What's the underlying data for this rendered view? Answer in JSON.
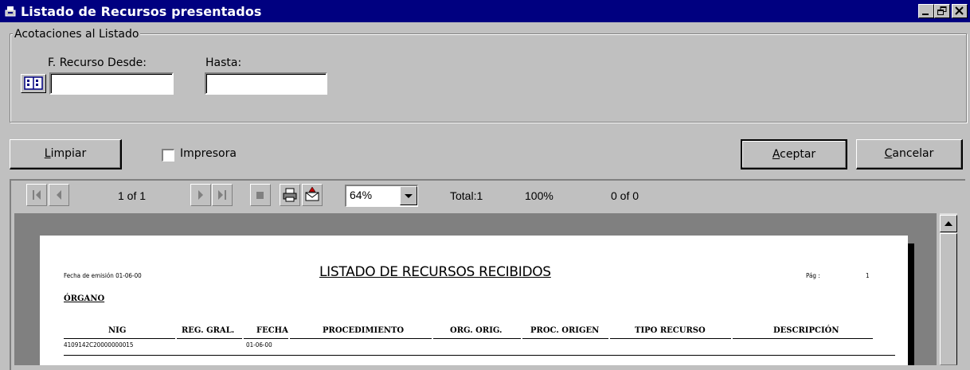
{
  "window": {
    "title": "Listado de Recursos presentados",
    "controls": [
      "minimize-icon",
      "maximize-icon",
      "close-icon"
    ]
  },
  "filters": {
    "group_label": "Acotaciones al Listado",
    "from_label": "F. Recurso Desde:",
    "from_value": "",
    "to_label": "Hasta:",
    "to_value": "",
    "calendar_icon": "calendar-icon"
  },
  "actions": {
    "clear_label": "Limpiar",
    "printer_label": "Impresora",
    "printer_checked": false,
    "accept_label": "Aceptar",
    "cancel_label": "Cancelar"
  },
  "viewer": {
    "page_indicator": "1 of 1",
    "zoom": "64%",
    "total": "Total:1",
    "percent": "100%",
    "match_count": "0 of 0"
  },
  "report": {
    "issue_date": "Fecha de emisión  01-06-00",
    "title": "LISTADO DE RECURSOS RECIBIDOS",
    "page_label": "Pág :",
    "page_number": "1",
    "section": "ÓRGANO",
    "columns": [
      "NIG",
      "REG. GRAL.",
      "FECHA",
      "PROCEDIMIENTO",
      "ORG. ORIG.",
      "PROC. ORIGEN",
      "TIPO RECURSO",
      "DESCRIPCIÓN"
    ],
    "rows": [
      {
        "nig": "4109142C20000000015",
        "reg_gral": "",
        "fecha": "01-06-00"
      }
    ]
  }
}
